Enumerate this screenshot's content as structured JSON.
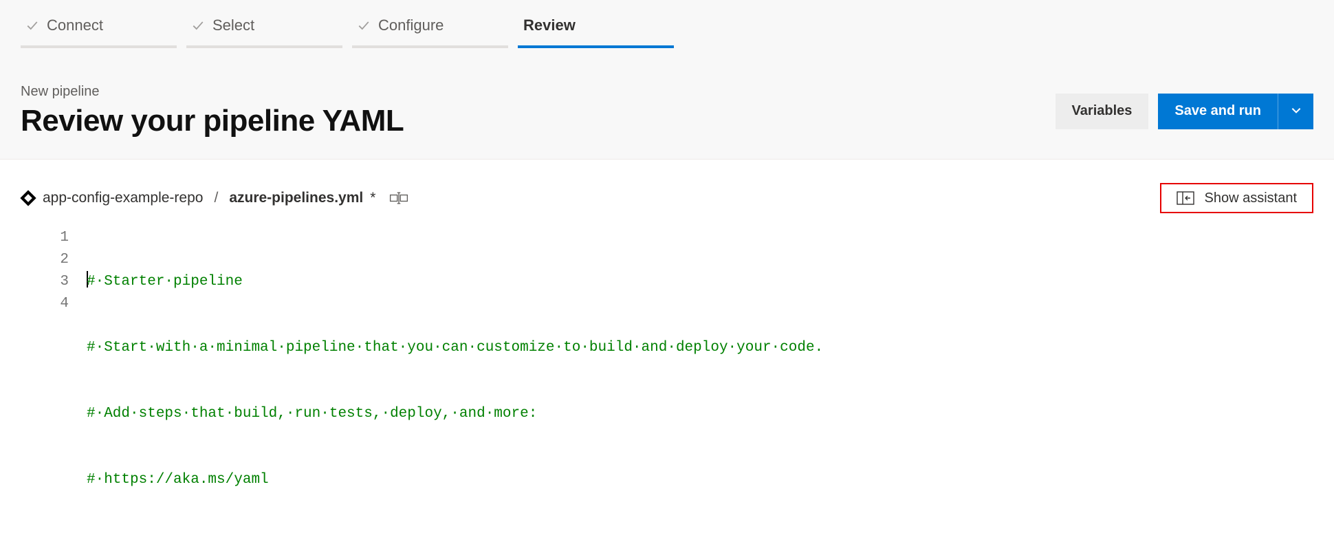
{
  "stepper": {
    "steps": [
      {
        "label": "Connect",
        "completed": true,
        "active": false
      },
      {
        "label": "Select",
        "completed": true,
        "active": false
      },
      {
        "label": "Configure",
        "completed": true,
        "active": false
      },
      {
        "label": "Review",
        "completed": false,
        "active": true
      }
    ]
  },
  "header": {
    "crumb": "New pipeline",
    "title": "Review your pipeline YAML"
  },
  "actions": {
    "variables": "Variables",
    "saveRun": "Save and run"
  },
  "path": {
    "repo": "app-config-example-repo",
    "sep": "/",
    "file": "azure-pipelines.yml",
    "dirty": "*"
  },
  "assistant": {
    "label": "Show assistant"
  },
  "editor": {
    "gutter": [
      "1",
      "2",
      "3",
      "4"
    ],
    "lines": [
      "#·Starter·pipeline",
      "#·Start·with·a·minimal·pipeline·that·you·can·customize·to·build·and·deploy·your·code.",
      "#·Add·steps·that·build,·run·tests,·deploy,·and·more:",
      "#·https://aka.ms/yaml"
    ]
  }
}
